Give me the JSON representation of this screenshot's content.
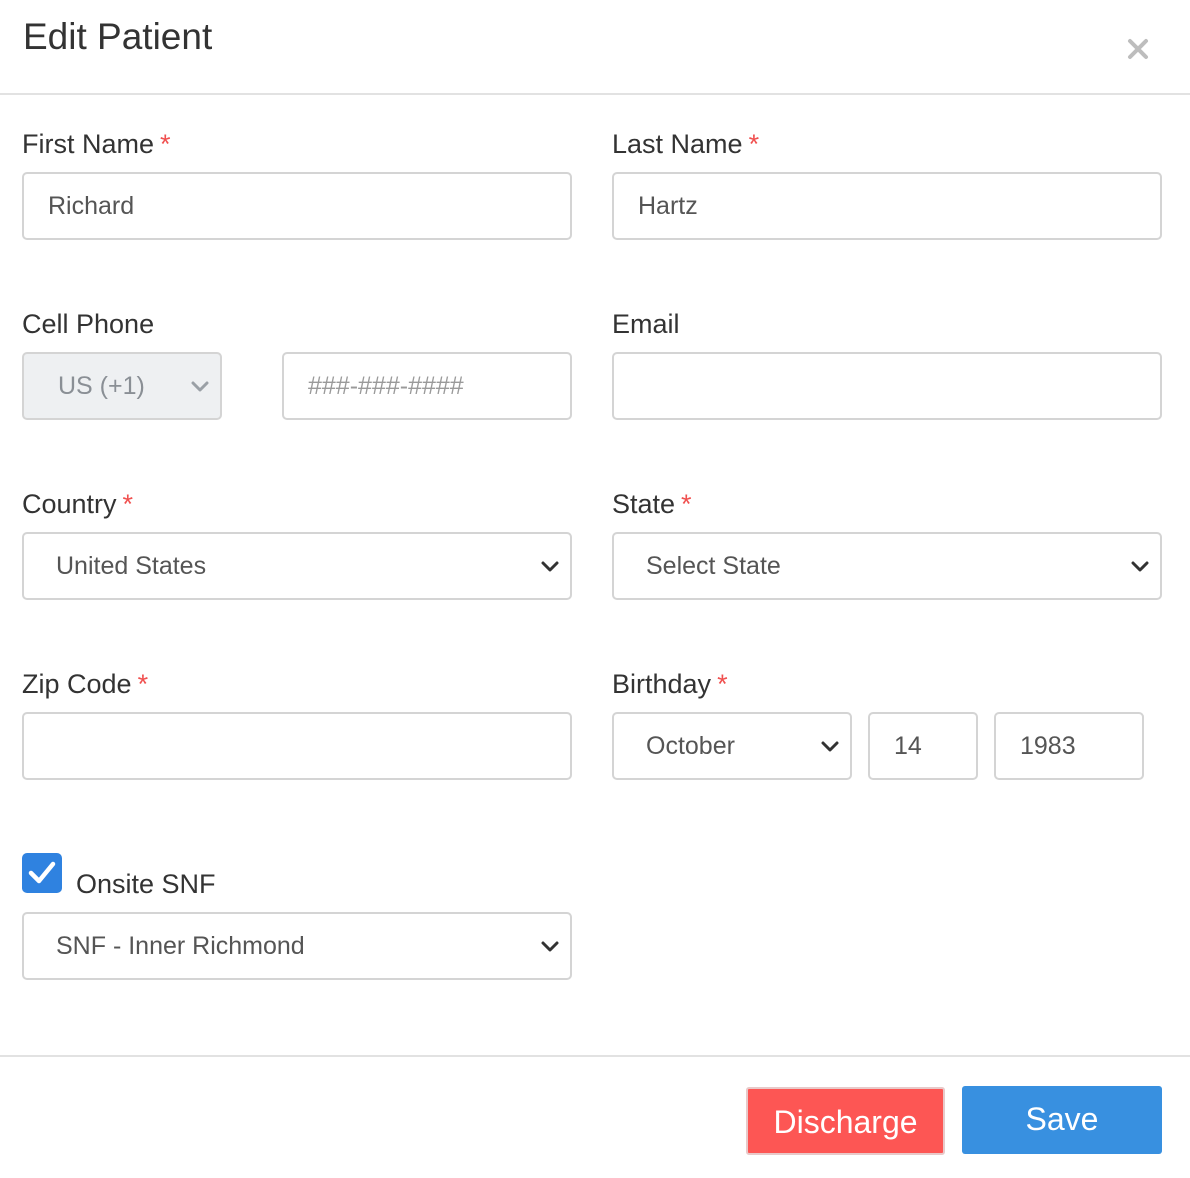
{
  "modal": {
    "title": "Edit Patient",
    "close_icon": "close-icon"
  },
  "form": {
    "required_mark": "*",
    "first_name": {
      "label": "First Name",
      "value": "Richard"
    },
    "last_name": {
      "label": "Last Name",
      "value": "Hartz"
    },
    "cell_phone": {
      "label": "Cell Phone",
      "country_code": "US (+1)",
      "placeholder": "###-###-####",
      "value": ""
    },
    "email": {
      "label": "Email",
      "value": ""
    },
    "country": {
      "label": "Country",
      "selected": "United States"
    },
    "state": {
      "label": "State",
      "selected": "Select State"
    },
    "zip_code": {
      "label": "Zip Code",
      "value": ""
    },
    "birthday": {
      "label": "Birthday",
      "month": "October",
      "day": "14",
      "year": "1983"
    },
    "onsite_snf": {
      "label": "Onsite SNF",
      "checked": true,
      "selected": "SNF - Inner Richmond"
    }
  },
  "footer": {
    "discharge_label": "Discharge",
    "save_label": "Save"
  },
  "colors": {
    "required": "#f0504f",
    "checkbox": "#2f82e0",
    "discharge": "#fd5654",
    "save": "#3890e0"
  }
}
